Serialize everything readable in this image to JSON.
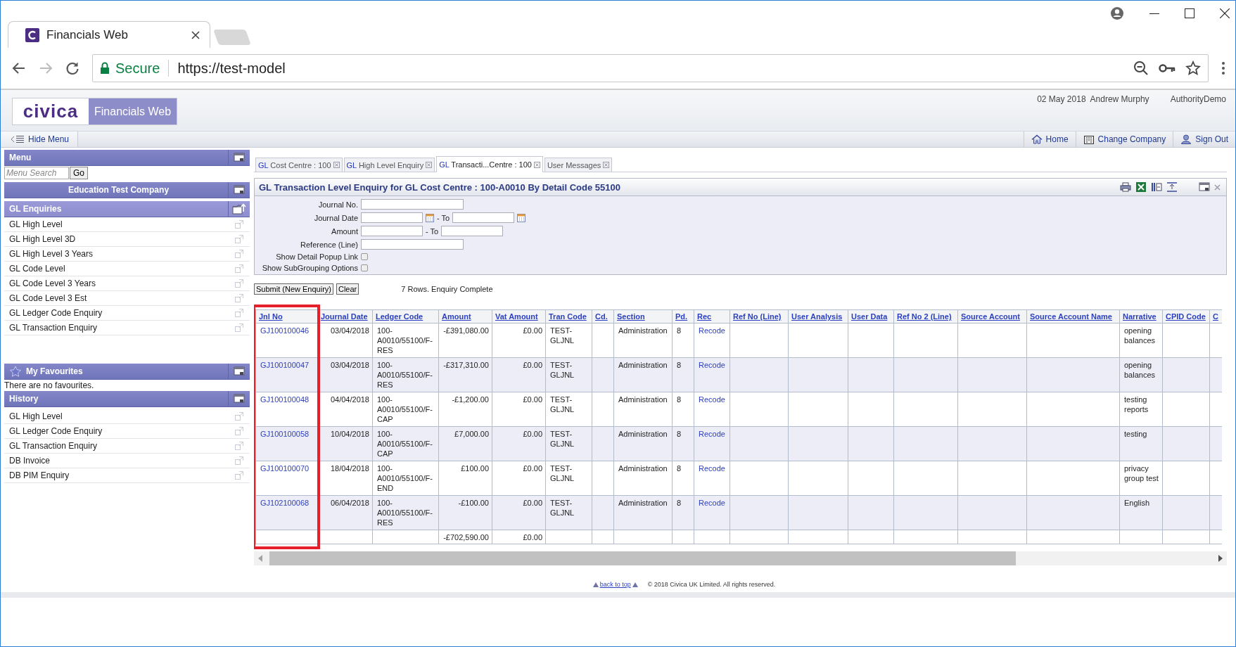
{
  "browser": {
    "tab_title": "Financials Web",
    "secure_label": "Secure",
    "url": "https://test-model"
  },
  "header": {
    "logo": "civica",
    "product": "Financials Web",
    "date": "02 May 2018",
    "user": "Andrew Murphy",
    "authority": "AuthorityDemo"
  },
  "navbar": {
    "hide_menu": "Hide Menu",
    "links": [
      {
        "label": "Home",
        "kind": "home"
      },
      {
        "label": "Change Company",
        "kind": "company"
      },
      {
        "label": "Sign Out",
        "kind": "signout"
      }
    ]
  },
  "sidebar": {
    "menu_title": "Menu",
    "search": {
      "placeholder": "Menu Search"
    },
    "go": "Go",
    "company": "Education Test Company",
    "sections": [
      {
        "kind": "enquiries",
        "title": "GL Enquiries",
        "items": [
          "GL High Level",
          "GL High Level 3D",
          "GL High Level 3 Years",
          "GL Code Level",
          "GL Code Level 3 Years",
          "GL Code Level 3 Est",
          "GL Ledger Code Enquiry",
          "GL Transaction Enquiry"
        ]
      },
      {
        "kind": "favourites",
        "title": "My Favourites",
        "empty_text": "There are no favourites."
      },
      {
        "kind": "history",
        "title": "History",
        "items": [
          "GL High Level",
          "GL Ledger Code Enquiry",
          "GL Transaction Enquiry",
          "DB Invoice",
          "DB PIM Enquiry"
        ]
      }
    ]
  },
  "tabs": [
    {
      "prefix": "GL",
      "label": "Cost Centre : 100",
      "selected": false
    },
    {
      "prefix": "GL",
      "label": "High Level Enquiry",
      "selected": false
    },
    {
      "prefix": "GL",
      "label": "Transacti...Centre : 100",
      "selected": true
    },
    {
      "label": "User Messages",
      "selected": false
    }
  ],
  "panel": {
    "title": "GL Transaction Level Enquiry for GL Cost Centre : 100-A0010 By Detail Code 55100",
    "fields": [
      {
        "kind": "text",
        "label": "Journal No."
      },
      {
        "kind": "date-range",
        "label": "Journal Date",
        "to": "- To"
      },
      {
        "kind": "range",
        "label": "Amount",
        "to": "- To"
      },
      {
        "kind": "text",
        "label": "Reference (Line)"
      },
      {
        "kind": "checkbox",
        "label": "Show Detail Popup Link",
        "checked": false
      },
      {
        "kind": "checkbox",
        "label": "Show SubGrouping Options",
        "checked": false
      }
    ],
    "buttons": [
      "Submit (New Enquiry)",
      "Clear"
    ],
    "status": "7 Rows. Enquiry Complete"
  },
  "table": {
    "columns": [
      {
        "label": "Jnl No",
        "highlighted": true
      },
      {
        "label": "Journal Date",
        "highlighted": false
      },
      {
        "label": "Ledger Code",
        "highlighted": false
      },
      {
        "label": "Amount",
        "highlighted": false
      },
      {
        "label": "Vat Amount",
        "highlighted": false
      },
      {
        "label": "Tran Code",
        "highlighted": false
      },
      {
        "label": "Cd.",
        "highlighted": false
      },
      {
        "label": "Section",
        "highlighted": false
      },
      {
        "label": "Pd.",
        "highlighted": false
      },
      {
        "label": "Rec",
        "highlighted": false
      },
      {
        "label": "Ref No (Line)",
        "highlighted": false
      },
      {
        "label": "User Analysis",
        "highlighted": false
      },
      {
        "label": "User Data",
        "highlighted": false
      },
      {
        "label": "Ref No 2 (Line)",
        "highlighted": false
      },
      {
        "label": "Source Account",
        "highlighted": false
      },
      {
        "label": "Source Account Name",
        "highlighted": false
      },
      {
        "label": "Narrative",
        "highlighted": false
      },
      {
        "label": "CPID Code",
        "highlighted": false
      },
      {
        "label": "C",
        "highlighted": false
      }
    ],
    "rows": [
      {
        "jnl_no": "GJ100100046",
        "journal_date": "03/04/2018",
        "ledger_code": "100-A0010/55100/F-RES",
        "amount": "-£391,080.00",
        "vat_amount": "£0.00",
        "tran_code": "TEST-GLJNL",
        "section": "Administration",
        "pd": "8",
        "rec": "Recode",
        "narrative": "opening balances"
      },
      {
        "jnl_no": "GJ100100047",
        "journal_date": "03/04/2018",
        "ledger_code": "100-A0010/55100/F-RES",
        "amount": "-£317,310.00",
        "vat_amount": "£0.00",
        "tran_code": "TEST-GLJNL",
        "section": "Administration",
        "pd": "8",
        "rec": "Recode",
        "narrative": "opening balances"
      },
      {
        "jnl_no": "GJ100100048",
        "journal_date": "04/04/2018",
        "ledger_code": "100-A0010/55100/F-CAP",
        "amount": "-£1,200.00",
        "vat_amount": "£0.00",
        "tran_code": "TEST-GLJNL",
        "section": "Administration",
        "pd": "8",
        "rec": "Recode",
        "narrative": "testing reports"
      },
      {
        "jnl_no": "GJ100100058",
        "journal_date": "10/04/2018",
        "ledger_code": "100-A0010/55100/F-CAP",
        "amount": "£7,000.00",
        "vat_amount": "£0.00",
        "tran_code": "TEST-GLJNL",
        "section": "Administration",
        "pd": "8",
        "rec": "Recode",
        "narrative": "testing"
      },
      {
        "jnl_no": "GJ100100070",
        "journal_date": "18/04/2018",
        "ledger_code": "100-A0010/55100/F-END",
        "amount": "£100.00",
        "vat_amount": "£0.00",
        "tran_code": "TEST-GLJNL",
        "section": "Administration",
        "pd": "8",
        "rec": "Recode",
        "narrative": "privacy group test"
      },
      {
        "jnl_no": "GJ102100068",
        "journal_date": "06/04/2018",
        "ledger_code": "100-A0010/55100/F-RES",
        "amount": "-£100.00",
        "vat_amount": "£0.00",
        "tran_code": "TEST-GLJNL",
        "section": "Administration",
        "pd": "8",
        "rec": "Recode",
        "narrative": "English"
      }
    ],
    "total": {
      "amount": "-£702,590.00",
      "vat_amount": "£0.00"
    }
  },
  "footer": {
    "back_to_top": "back to top",
    "copyright": "© 2018 Civica UK Limited. All rights reserved."
  }
}
